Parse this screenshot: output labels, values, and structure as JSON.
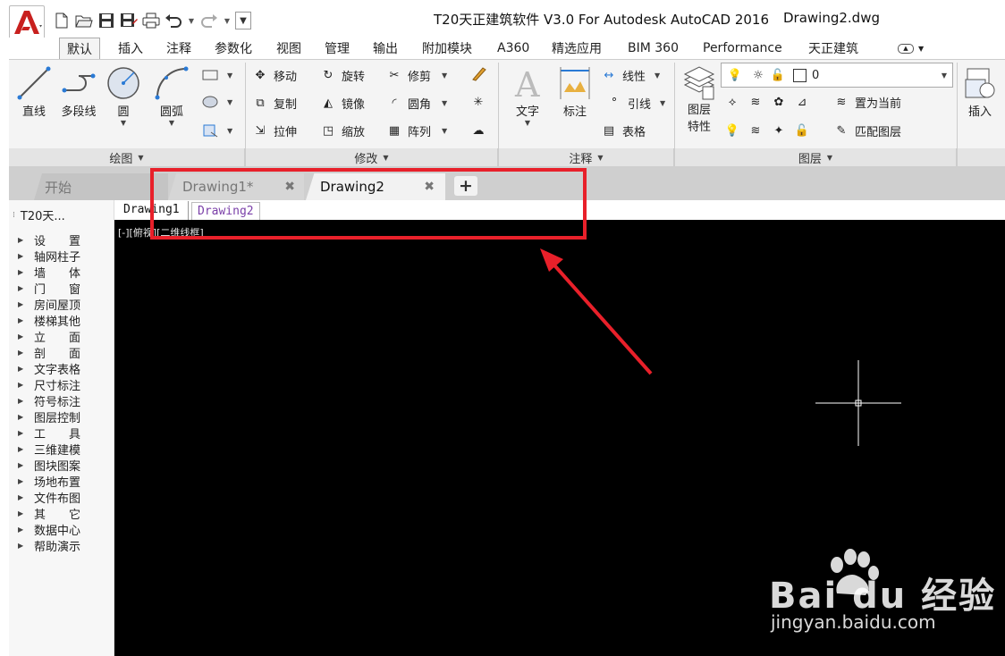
{
  "titlebar": {
    "title": "T20天正建筑软件 V3.0 For Autodesk AutoCAD 2016",
    "document": "Drawing2.dwg"
  },
  "ribbon_tabs": [
    "默认",
    "插入",
    "注释",
    "参数化",
    "视图",
    "管理",
    "输出",
    "附加模块",
    "A360",
    "精选应用",
    "BIM 360",
    "Performance",
    "天正建筑"
  ],
  "draw_panel": {
    "label": "绘图",
    "tools": [
      "直线",
      "多段线",
      "圆",
      "圆弧"
    ]
  },
  "modify_panel": {
    "label": "修改",
    "tools": [
      "移动",
      "旋转",
      "修剪",
      "复制",
      "镜像",
      "圆角",
      "拉伸",
      "缩放",
      "阵列"
    ]
  },
  "annotation_panel": {
    "label": "注释",
    "tools": [
      "文字",
      "标注",
      "线性",
      "引线",
      "表格"
    ]
  },
  "layer_panel": {
    "label": "图层",
    "properties_label": "图层\n特性",
    "current_layer": "0",
    "set_current": "置为当前",
    "match_layer": "匹配图层"
  },
  "insert_panel": {
    "label": "插入"
  },
  "doc_tabs": {
    "start": "开始",
    "drawing1": "Drawing1*",
    "drawing2": "Drawing2",
    "add": "+"
  },
  "layout_tabs": [
    "Drawing1",
    "Drawing2"
  ],
  "viewport_label": "[-][俯视][二维线框]",
  "palette": {
    "title": "T20天...",
    "items": [
      "设　　置",
      "轴网柱子",
      "墙　　体",
      "门　　窗",
      "房间屋顶",
      "楼梯其他",
      "立　　面",
      "剖　　面",
      "文字表格",
      "尺寸标注",
      "符号标注",
      "图层控制",
      "工　　具",
      "三维建模",
      "图块图案",
      "场地布置",
      "文件布图",
      "其　　它",
      "数据中心",
      "帮助演示"
    ]
  },
  "watermark": {
    "brand": "Bai du 经验",
    "url": "jingyan.baidu.com"
  },
  "colors": {
    "highlight": "#e8202a",
    "canvas": "#000000",
    "active_layout_tab": "#7a3fa8"
  }
}
